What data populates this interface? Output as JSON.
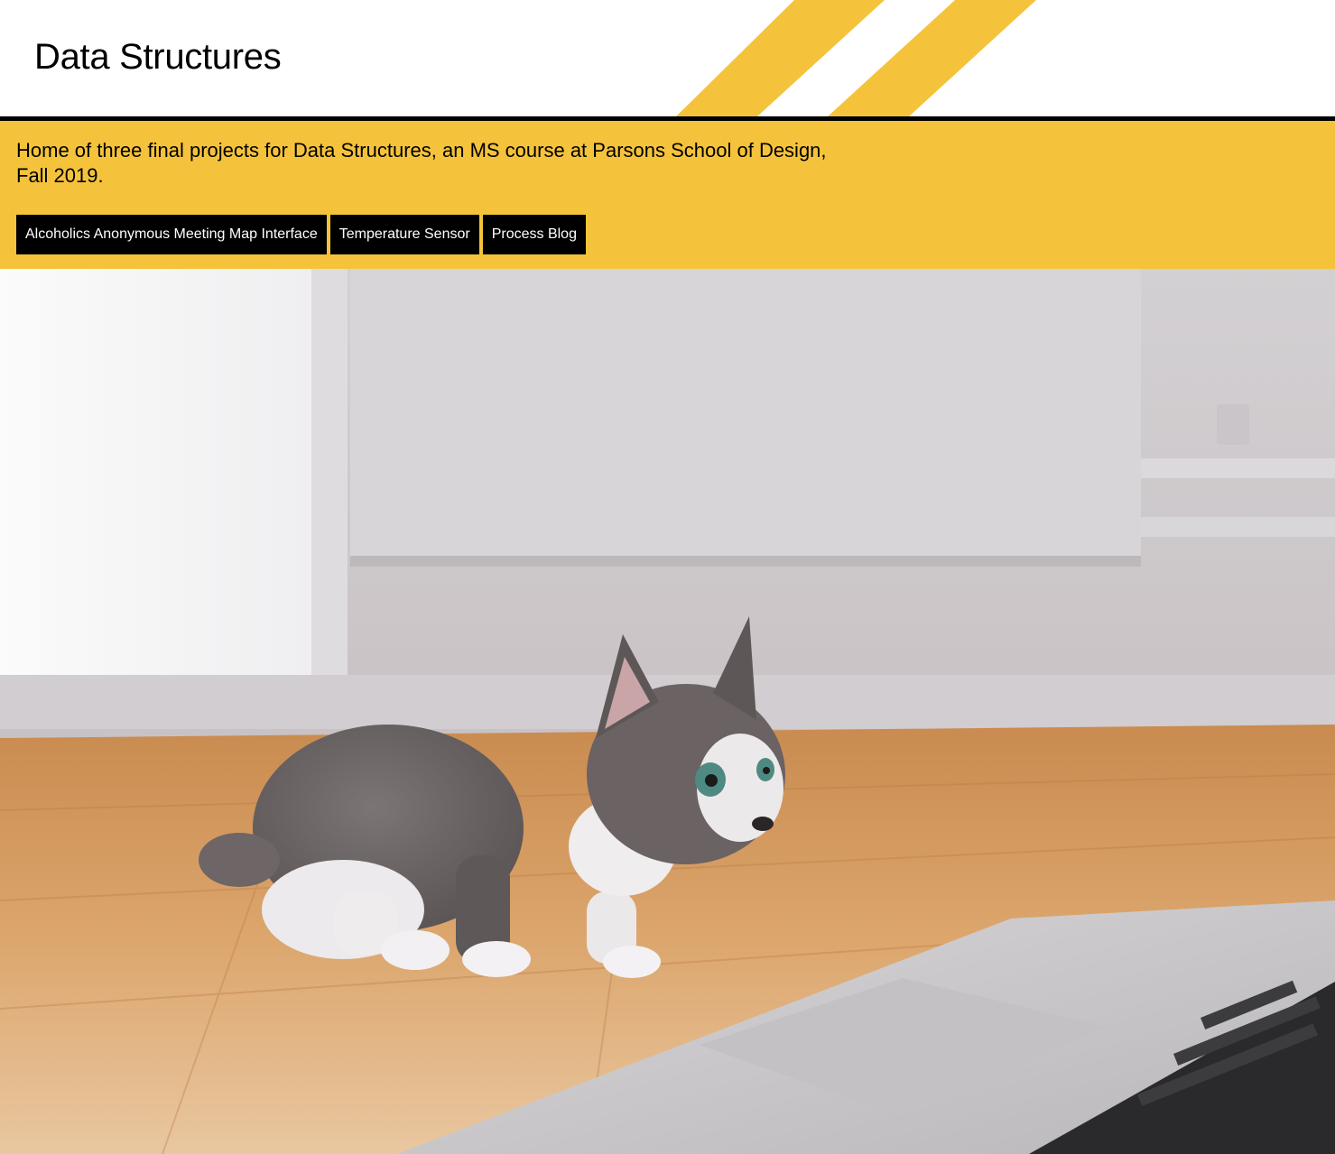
{
  "header": {
    "title": "Data Structures"
  },
  "banner": {
    "tagline": "Home of three final projects for Data Structures, an MS course at Parsons School of Design, Fall 2019.",
    "nav": [
      {
        "label": "Alcoholics Anonymous Meeting Map Interface"
      },
      {
        "label": "Temperature Sensor"
      },
      {
        "label": "Process Blog"
      }
    ]
  },
  "hero": {
    "icon": "kitten-and-laptop-photo"
  },
  "colors": {
    "accent": "#f5c33b",
    "text": "#000000",
    "button_bg": "#000000",
    "button_text": "#ffffff"
  }
}
